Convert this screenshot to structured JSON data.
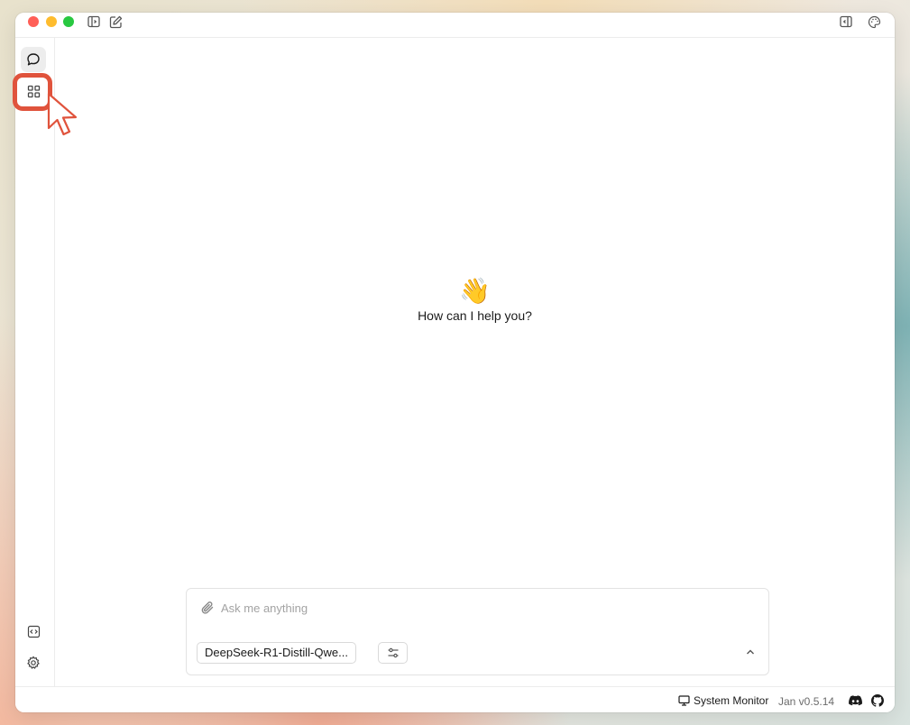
{
  "window": {
    "traffic_lights": [
      "close",
      "minimize",
      "zoom"
    ],
    "titlebar_left_icons": [
      "sidebar-toggle-icon",
      "new-chat-icon"
    ],
    "titlebar_right_icons": [
      "right-panel-icon",
      "palette-icon"
    ]
  },
  "sidebar": {
    "items": [
      {
        "icon": "chat-bubble-icon",
        "active": true
      },
      {
        "icon": "grid-icon",
        "active": false
      }
    ],
    "bottom_items": [
      {
        "icon": "code-icon"
      },
      {
        "icon": "gear-icon"
      }
    ]
  },
  "main": {
    "emoji": "👋",
    "greeting": "How can I help you?"
  },
  "composer": {
    "placeholder": "Ask me anything",
    "value": "",
    "model_label": "DeepSeek-R1-Distill-Qwe...",
    "icons": [
      "paperclip-icon",
      "sliders-icon",
      "chevron-up-icon"
    ]
  },
  "footer": {
    "system_monitor": "System Monitor",
    "version": "Jan v0.5.14",
    "icons": [
      "monitor-icon",
      "discord-icon",
      "github-icon"
    ]
  },
  "annotation": {
    "highlight_color": "#e0533c"
  }
}
